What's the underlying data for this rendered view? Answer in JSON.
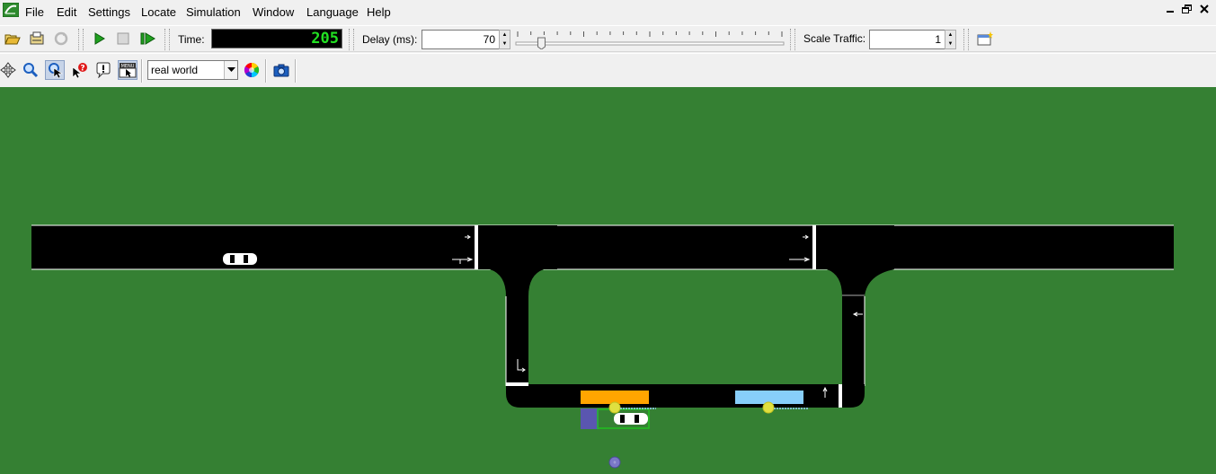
{
  "menu": {
    "items": [
      "File",
      "Edit",
      "Settings",
      "Locate",
      "Simulation",
      "Window",
      "Language",
      "Help"
    ]
  },
  "window_controls": [
    "minimize-icon",
    "restore-icon",
    "close-icon"
  ],
  "toolbar": {
    "time_label": "Time:",
    "time_value": "205",
    "delay_label": "Delay (ms):",
    "delay_value": "70",
    "delay_slider_fraction": 0.09,
    "scale_label": "Scale Traffic:",
    "scale_value": "1"
  },
  "view_toolbar": {
    "scheme_selected": "real world"
  },
  "colors": {
    "grass": "#358033",
    "road": "#000000",
    "time_digits": "#22e022",
    "bus_stop_orange": "#ffa500",
    "bus_stop_lightblue": "#87cefa",
    "poi_yellow": "#e0e040",
    "container_stop": "#5a56b0"
  }
}
